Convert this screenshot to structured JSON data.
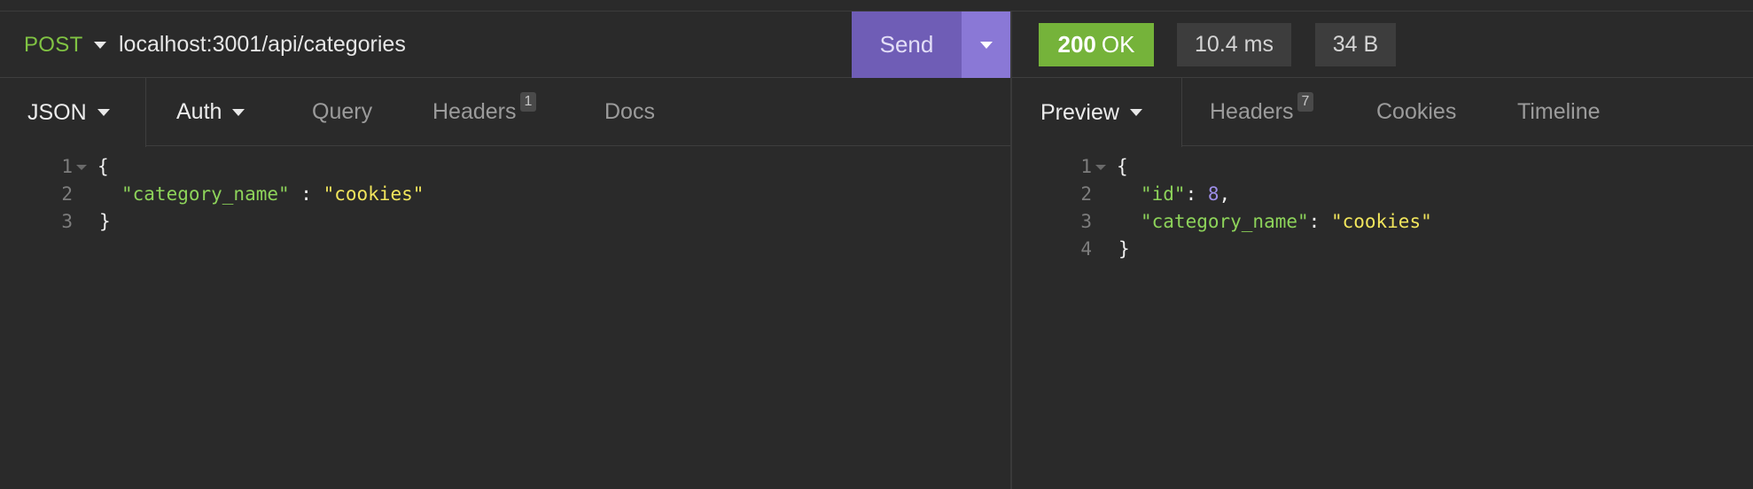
{
  "request": {
    "method": "POST",
    "url": "localhost:3001/api/categories",
    "send_label": "Send",
    "tabs": {
      "body": "JSON",
      "auth": "Auth",
      "query": "Query",
      "headers": "Headers",
      "headers_count": "1",
      "docs": "Docs"
    },
    "body_lines": [
      {
        "num": "1",
        "text": "{"
      },
      {
        "num": "2",
        "key": "\"category_name\"",
        "sep": " : ",
        "value": "\"cookies\""
      },
      {
        "num": "3",
        "text": "}"
      }
    ]
  },
  "response": {
    "status_code": "200",
    "status_text": "OK",
    "time": "10.4 ms",
    "size": "34 B",
    "tabs": {
      "preview": "Preview",
      "headers": "Headers",
      "headers_count": "7",
      "cookies": "Cookies",
      "timeline": "Timeline"
    },
    "body_lines": [
      {
        "num": "1",
        "text": "{"
      },
      {
        "num": "2",
        "key": "\"id\"",
        "sep": ": ",
        "value": "8",
        "trail": ","
      },
      {
        "num": "3",
        "key": "\"category_name\"",
        "sep": ": ",
        "value": "\"cookies\""
      },
      {
        "num": "4",
        "text": "}"
      }
    ]
  },
  "colors": {
    "method": "#80c343",
    "send": "#6f5db6",
    "send_dropdown": "#8a78d6",
    "status_ok": "#75b33a",
    "json_key": "#8dd35a",
    "json_string": "#f1e55c",
    "json_number": "#9d8ee8"
  },
  "icons": [
    "caret-down-icon",
    "fold-caret-icon"
  ]
}
